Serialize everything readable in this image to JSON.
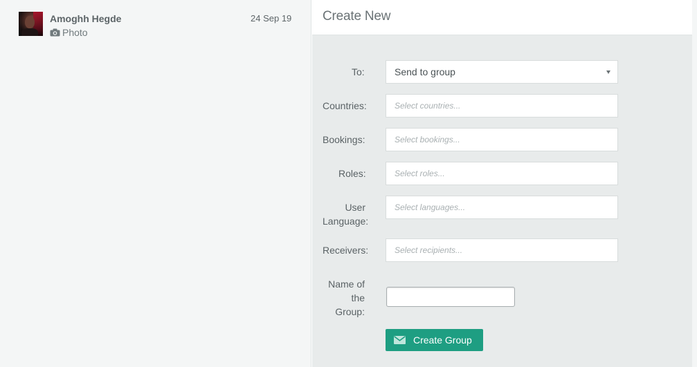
{
  "conversations": [
    {
      "name": "Amoghh Hegde",
      "preview": "Photo",
      "preview_icon": "camera-icon",
      "date": "24 Sep 19"
    }
  ],
  "create_panel": {
    "title": "Create New",
    "to": {
      "label": "To:",
      "value": "Send to group"
    },
    "countries": {
      "label": "Countries:",
      "placeholder": "Select countries..."
    },
    "bookings": {
      "label": "Bookings:",
      "placeholder": "Select bookings..."
    },
    "roles": {
      "label": "Roles:",
      "placeholder": "Select roles..."
    },
    "user_language": {
      "label_line1": "User",
      "label_line2": "Language:",
      "placeholder": "Select languages..."
    },
    "receivers": {
      "label": "Receivers:",
      "placeholder": "Select recipients..."
    },
    "group_name": {
      "label_line1": "Name of",
      "label_line2": "the",
      "label_line3": "Group:",
      "value": ""
    },
    "submit": {
      "label": "Create Group",
      "icon": "envelope-icon"
    }
  },
  "colors": {
    "left_bg": "#f4f6f6",
    "right_bg": "#e8ebeb",
    "accent": "#1e9e82",
    "text": "#5a6265"
  }
}
